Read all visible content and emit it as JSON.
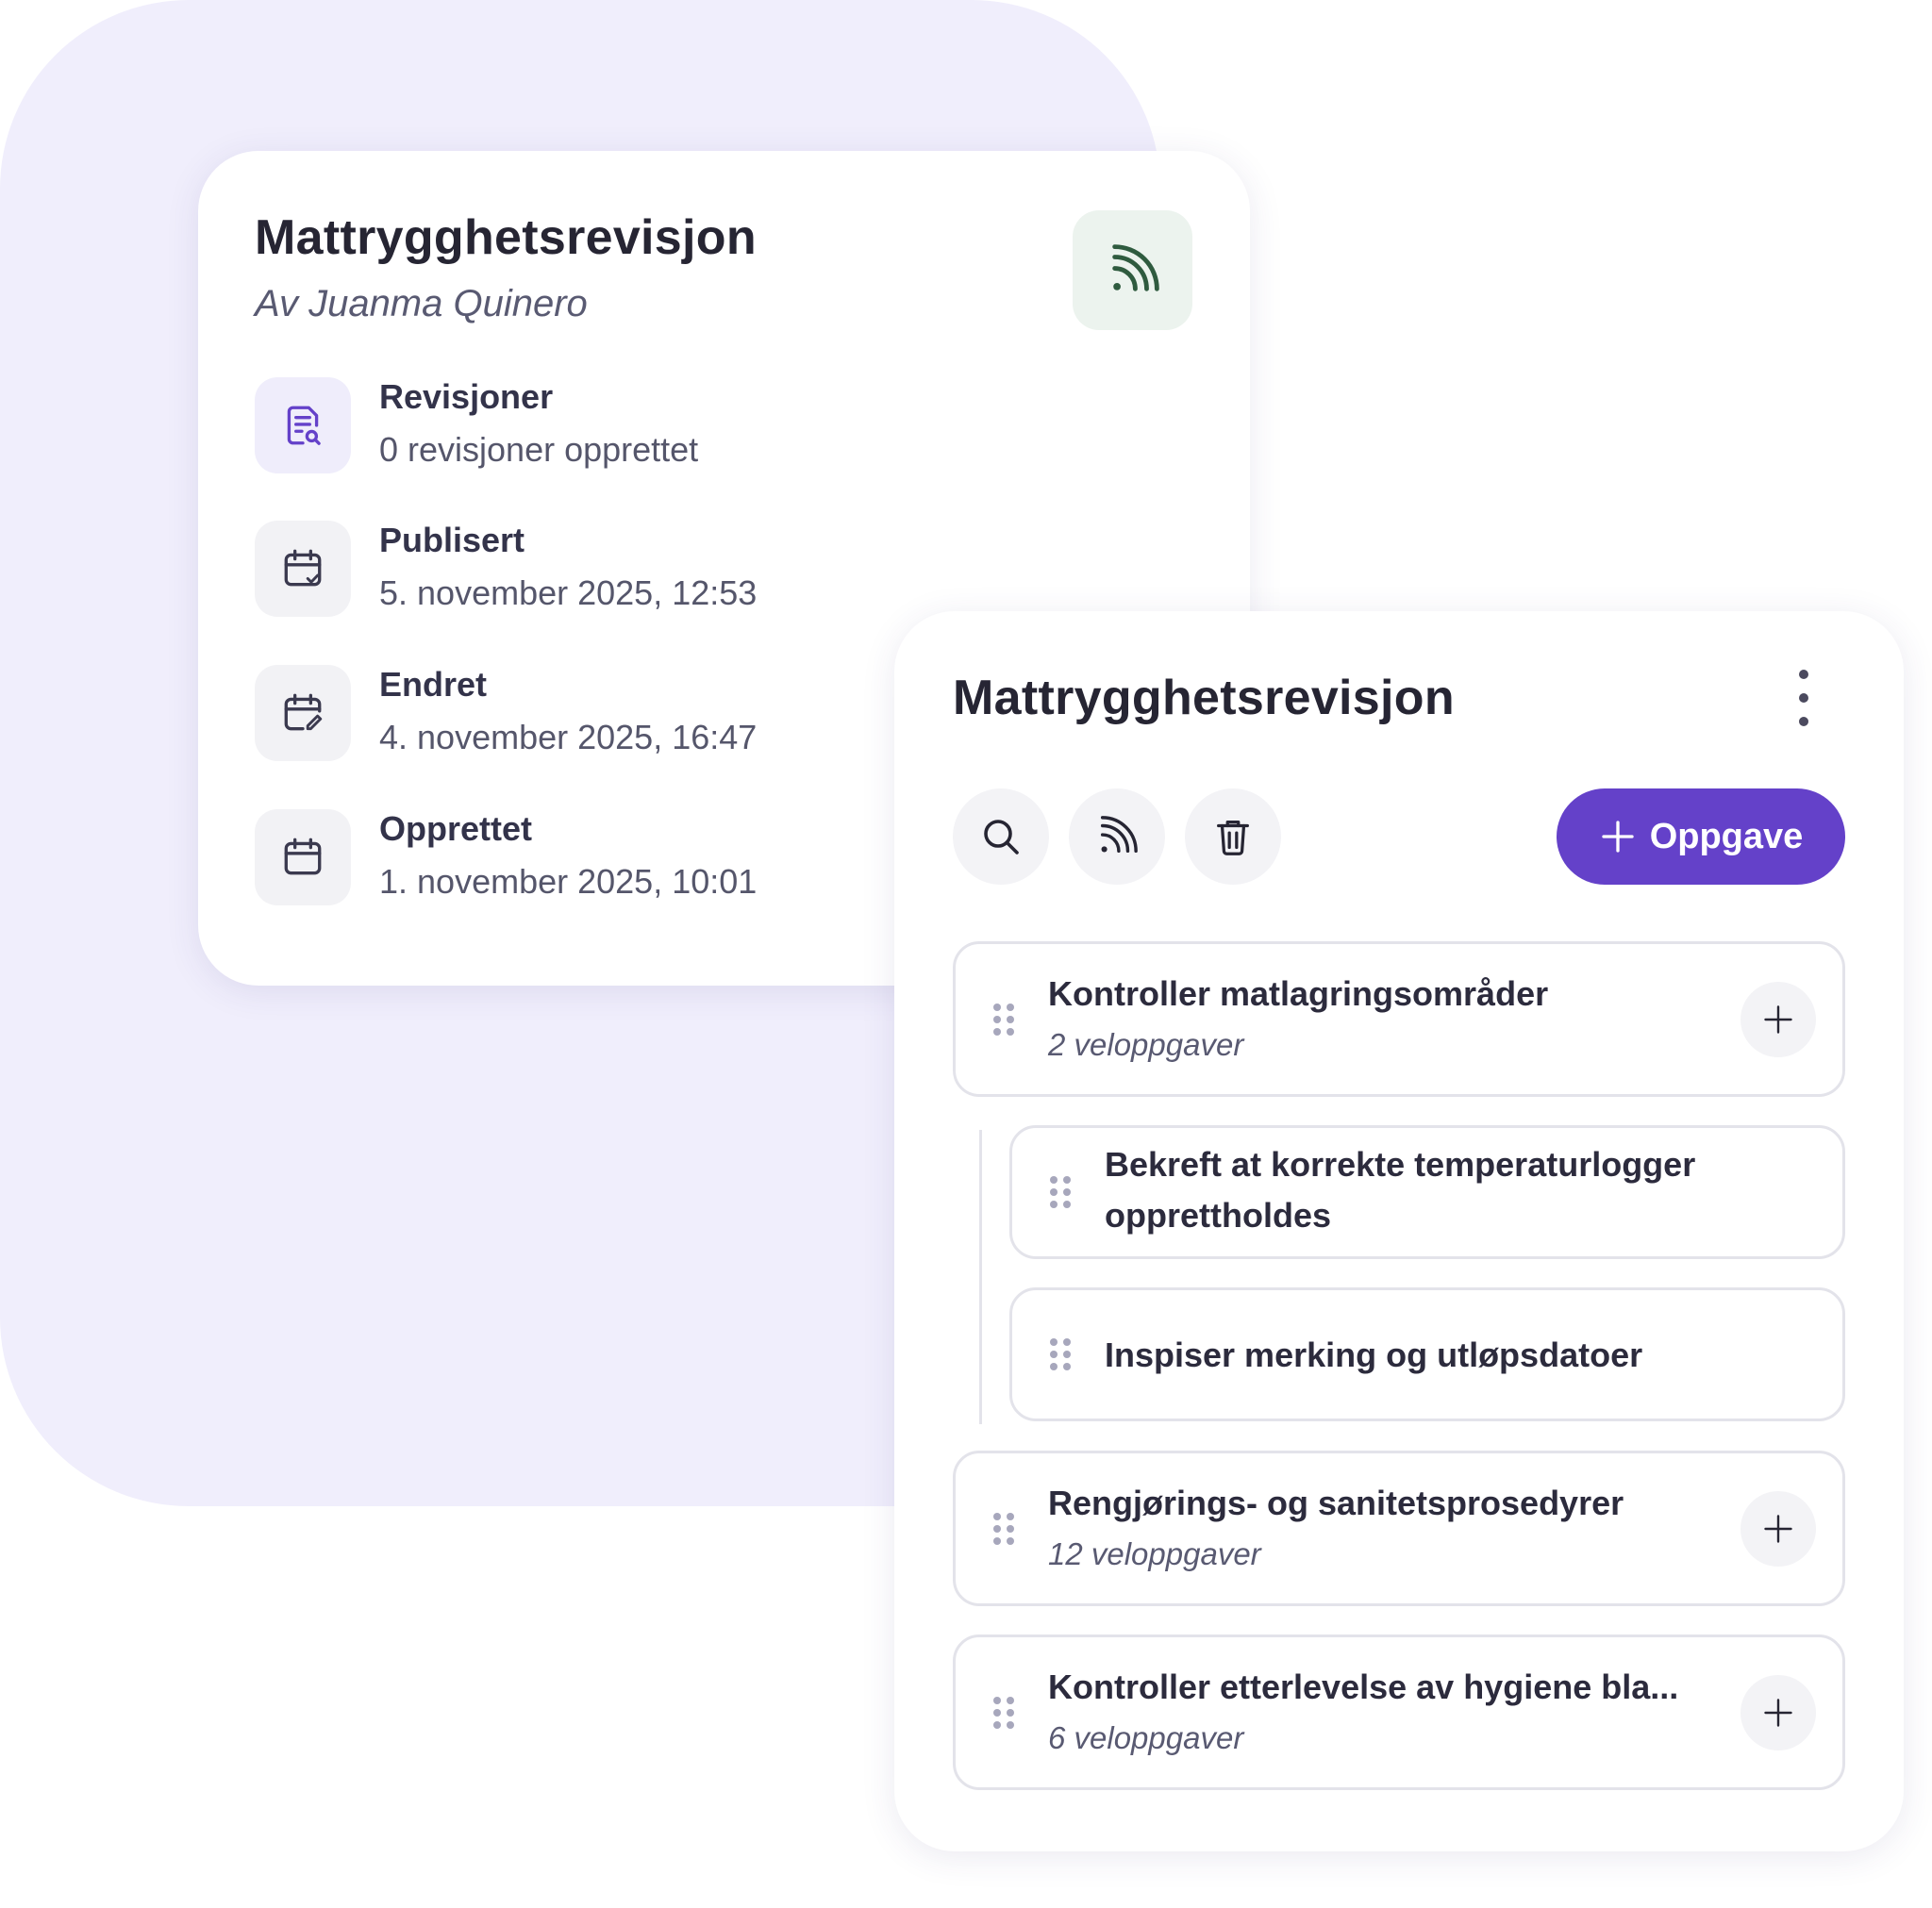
{
  "info_card": {
    "title": "Mattrygghetsrevisjon",
    "author": "Av Juanma Quinero",
    "badge_icon": "rss-feed-icon",
    "rows": [
      {
        "icon": "document-search-icon",
        "label": "Revisjoner",
        "value": "0 revisjoner opprettet"
      },
      {
        "icon": "calendar-check-icon",
        "label": "Publisert",
        "value": "5. november 2025, 12:53"
      },
      {
        "icon": "calendar-edit-icon",
        "label": "Endret",
        "value": "4. november 2025, 16:47"
      },
      {
        "icon": "calendar-icon",
        "label": "Opprettet",
        "value": "1. november 2025, 10:01"
      }
    ]
  },
  "tasks_card": {
    "title": "Mattrygghetsrevisjon",
    "toolbar": {
      "icons": [
        "search-icon",
        "rss-feed-icon",
        "trash-icon"
      ],
      "add_button_label": "Oppgave"
    },
    "tasks": [
      {
        "title": "Kontroller matlagringsområder",
        "subtitle": "2 veloppgaver",
        "subtasks": [
          {
            "title_line1": "Bekreft at korrekte temperaturlogger",
            "title_line2": "opprettholdes"
          },
          {
            "title_line1": "Inspiser merking og utløpsdatoer"
          }
        ]
      },
      {
        "title": "Rengjørings- og sanitetsprosedyrer",
        "subtitle": "12 veloppgaver"
      },
      {
        "title": "Kontroller etterlevelse av hygiene bla...",
        "subtitle": "6 veloppgaver"
      }
    ]
  },
  "colors": {
    "background_blob": "#f0eefc",
    "accent": "#6441c9",
    "feed_badge": "#ecf3ee",
    "feed_icon": "#2f5b3f"
  }
}
